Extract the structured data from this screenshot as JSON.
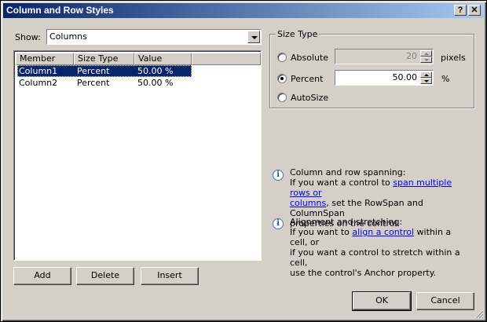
{
  "window": {
    "title": "Column and Row Styles",
    "help_button": "?",
    "close_button": "✕"
  },
  "show": {
    "label": "Show:",
    "selected": "Columns"
  },
  "list": {
    "headers": [
      "Member",
      "Size Type",
      "Value"
    ],
    "rows": [
      {
        "member": "Column1",
        "size_type": "Percent",
        "value": "50.00 %",
        "selected": true
      },
      {
        "member": "Column2",
        "size_type": "Percent",
        "value": "50.00 %",
        "selected": false
      }
    ]
  },
  "buttons": {
    "add": "Add",
    "delete": "Delete",
    "insert": "Insert",
    "ok": "OK",
    "cancel": "Cancel"
  },
  "size_type": {
    "title": "Size Type",
    "absolute": {
      "label": "Absolute",
      "value": "20",
      "unit": "pixels",
      "checked": false
    },
    "percent": {
      "label": "Percent",
      "value": "50.00",
      "unit": "%",
      "checked": true
    },
    "autosize": {
      "label": "AutoSize",
      "checked": false
    }
  },
  "info": {
    "spanning": {
      "heading": "Column  and  row  spanning:",
      "pre": "If you want a control to ",
      "link": "span multiple rows or",
      "link2": "columns",
      "post": ", set the RowSpan and ColumnSpan",
      "post2": "properties on the control."
    },
    "alignment": {
      "heading": "Alignment  and  stretching:",
      "pre": "If you want to ",
      "link": "align a control",
      "post": " within a cell, or",
      "line2": "if you want a control to stretch within a cell,",
      "line3": "use the control's Anchor property."
    }
  }
}
